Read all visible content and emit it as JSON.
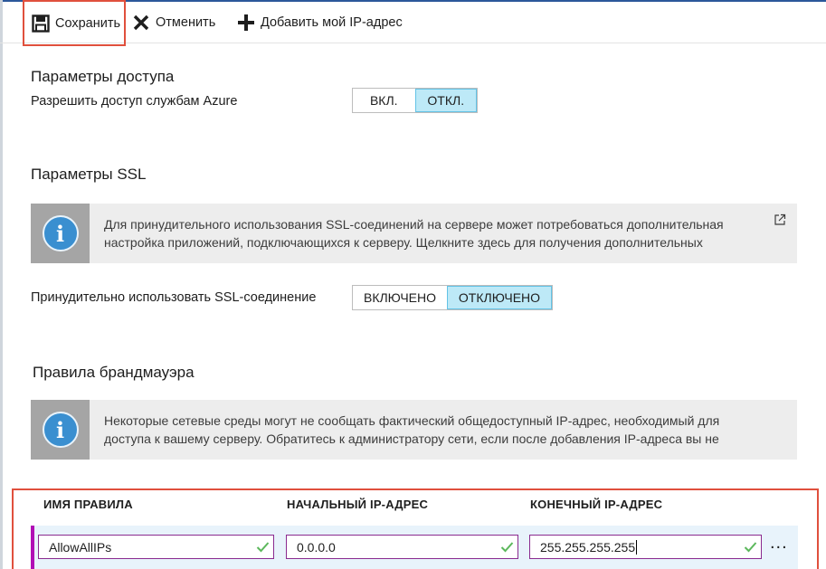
{
  "toolbar": {
    "save_label": "Сохранить",
    "cancel_label": "Отменить",
    "add_ip_label": "Добавить мой IP-адрес"
  },
  "access": {
    "title": "Параметры доступа",
    "allow_azure_label": "Разрешить доступ службам Azure",
    "on_label": "ВКЛ.",
    "off_label": "ОТКЛ.",
    "selected": "ОТКЛ."
  },
  "ssl": {
    "title": "Параметры SSL",
    "info_text": "Для принудительного использования SSL-соединений на сервере может потребоваться дополнительная настройка приложений, подключающихся к серверу. Щелкните здесь для получения дополнительных",
    "enforce_label": "Принудительно использовать SSL-соединение",
    "on_label": "ВКЛЮЧЕНО",
    "off_label": "ОТКЛЮЧЕНО",
    "selected": "ОТКЛЮЧЕНО"
  },
  "firewall": {
    "title": "Правила брандмауэра",
    "info_text": "Некоторые сетевые среды могут не сообщать фактический общедоступный IP-адрес, необходимый для доступа к вашему серверу. Обратитесь к администратору сети, если после добавления IP-адреса вы не",
    "columns": [
      "ИМЯ ПРАВИЛА",
      "НАЧАЛЬНЫЙ IP-АДРЕС",
      "КОНЕЧНЫЙ IP-АДРЕС"
    ],
    "rows": [
      {
        "rule_name": "AllowAllIPs",
        "start_ip": "0.0.0.0",
        "end_ip": "255.255.255.255"
      }
    ],
    "more_label": "..."
  },
  "icons": {
    "save": "save-icon",
    "cancel": "close-icon",
    "add": "plus-icon",
    "info": "info-icon",
    "external": "external-link-icon",
    "valid": "checkmark-icon"
  },
  "colors": {
    "highlight_border": "#e0503d",
    "toggle_active": "#bde9f7",
    "info_icon": "#3a8fd0",
    "row_accent": "#b10fb5",
    "check": "#5cb85c"
  }
}
